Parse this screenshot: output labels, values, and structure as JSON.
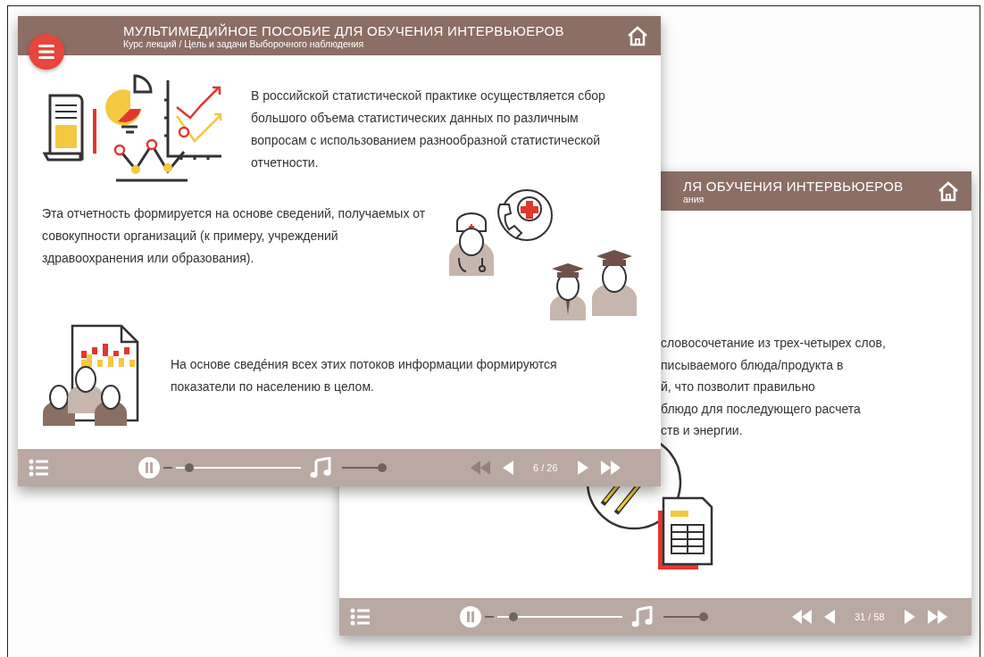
{
  "front_window": {
    "title": "МУЛЬТИМЕДИЙНОЕ ПОСОБИЕ ДЛЯ ОБУЧЕНИЯ ИНТЕРВЬЮЕРОВ",
    "breadcrumb": "Курс лекций / Цель и задачи Выборочного наблюдения",
    "sections": [
      {
        "kind": "statistics",
        "text": "В российской статистической практике осуществляется сбор большого объема статистических данных по различным вопросам с использованием разнообразной статистической отчетности."
      },
      {
        "kind": "organizations",
        "text": "Эта отчетность формируется на основе сведений, получаемых от совокупности организаций (к примеру, учреждений здравоохранения или образования)."
      },
      {
        "kind": "report",
        "text": "На основе сведéния всех этих потоков информации формируются показатели по населению в целом."
      }
    ],
    "footer": {
      "progress": {
        "level": 0.08
      },
      "volume": {
        "level": 1
      },
      "rewind": {
        "disabled": true
      },
      "page": "6 / 26"
    }
  },
  "back_window": {
    "title": "ЛЯ ОБУЧЕНИЯ ИНТЕРВЬЮЕРОВ",
    "breadcrumb": "ания",
    "text_lines": [
      "словосочетание из трех-четырех слов,",
      "писываемого блюда/продукта в",
      "й, что позволит правильно",
      "блюдо для последующего расчета",
      "ств и энергии."
    ],
    "footer": {
      "progress": {
        "level": 0.1
      },
      "volume": {
        "level": 1
      },
      "rewind": {
        "disabled": false
      },
      "page": "31 / 58"
    }
  }
}
